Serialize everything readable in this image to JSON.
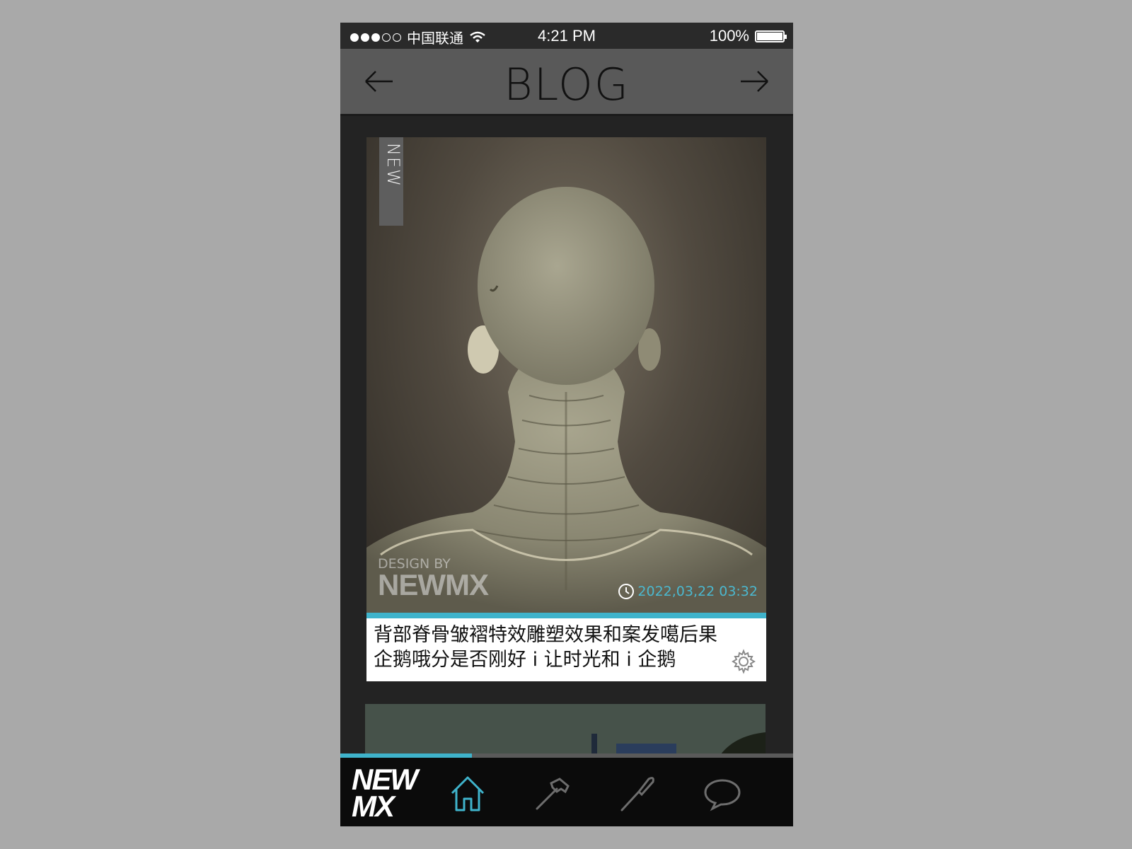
{
  "status_bar": {
    "carrier": "中国联通",
    "time": "4:21 PM",
    "battery": "100%"
  },
  "nav": {
    "title": "BLOG",
    "back_icon": "arrow-left-icon",
    "forward_icon": "arrow-right-icon"
  },
  "post": {
    "tag": "NEW",
    "watermark_top": "DESIGN BY",
    "watermark_brand": "NEWMX",
    "timestamp": "2022,03,22 03:32",
    "title_line1": "背部脊骨皱褶特效雕塑效果和案发噶后果",
    "title_line2": "企鹅哦分是否刚好 i 让时光和 i 企鹅",
    "settings_icon": "gear-icon"
  },
  "tab_bar": {
    "logo_line1": "NEW",
    "logo_line2": "MX",
    "tabs": [
      {
        "icon": "home-icon",
        "active": true
      },
      {
        "icon": "hammer-icon",
        "active": false
      },
      {
        "icon": "brush-icon",
        "active": false
      },
      {
        "icon": "chat-bubble-icon",
        "active": false
      }
    ]
  },
  "colors": {
    "accent": "#3fb3cb",
    "nav_bg": "#595959",
    "page_bg": "#232323",
    "tab_bg": "#0b0b0b"
  },
  "scroll_progress": 0.29
}
